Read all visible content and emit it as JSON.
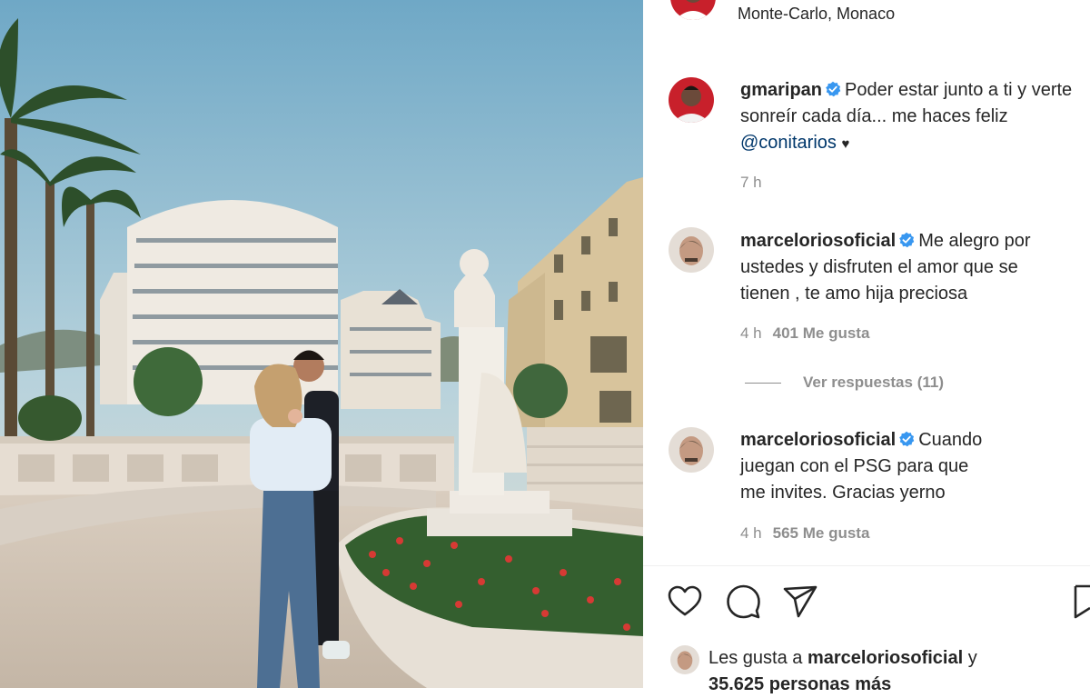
{
  "post_header": {
    "location": "Monte-Carlo, Monaco"
  },
  "caption": {
    "username": "gmaripan",
    "text": "Poder estar junto a ti y verte sonreír cada día... me haces feliz",
    "mention": "@conitarios",
    "heart": "♥",
    "time": "7 h"
  },
  "comments": [
    {
      "username": "marceloriosoficial",
      "text": "Me alegro por ustedes y disfruten el amor que se tienen , te amo hija preciosa",
      "time": "4 h",
      "likes": "401 Me gusta"
    },
    {
      "username": "marceloriosoficial",
      "text": "Cuando juegan con el PSG para que me invites. Gracias yerno",
      "time": "4 h",
      "likes": "565 Me gusta"
    }
  ],
  "replies_toggle": "Ver respuestas (11)",
  "actions": {
    "like": "heart-icon",
    "comment": "comment-icon",
    "share": "paper-plane-icon",
    "save": "bookmark-icon"
  },
  "likes_summary": {
    "prefix": "Les gusta a",
    "username": "marceloriosoficial",
    "joiner": "y",
    "others": "35.625 personas más"
  },
  "colors": {
    "verified_blue": "#3897f0",
    "mention_blue": "#00376b",
    "meta_grey": "#8e8e8e"
  }
}
